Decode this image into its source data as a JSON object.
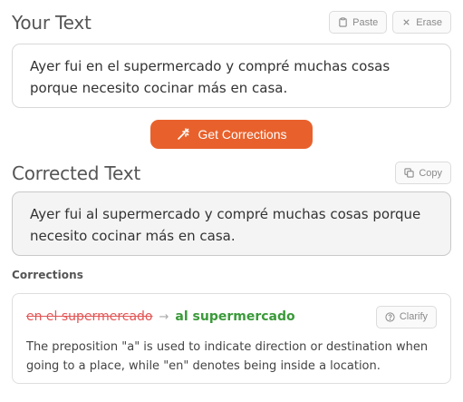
{
  "your_text": {
    "title": "Your Text",
    "paste_label": "Paste",
    "erase_label": "Erase",
    "content": "Ayer fui en el supermercado y compré muchas cosas porque necesito cocinar más en casa."
  },
  "action": {
    "label": "Get Corrections"
  },
  "corrected": {
    "title": "Corrected Text",
    "copy_label": "Copy",
    "content": "Ayer fui al supermercado y compré muchas cosas porque necesito cocinar más en casa."
  },
  "corrections": {
    "label": "Corrections",
    "items": [
      {
        "original": "en el supermercado",
        "arrow": "→",
        "corrected": "al supermercado",
        "clarify_label": "Clarify",
        "explanation": "The preposition \"a\" is used to indicate direction or destination when going to a place, while \"en\" denotes being inside a location."
      }
    ]
  },
  "colors": {
    "accent": "#e8612c",
    "removed": "#e35454",
    "added": "#3a9a3a"
  },
  "icons": {
    "paste": "clipboard-icon",
    "erase": "close-icon",
    "action": "magic-wand-icon",
    "copy": "copy-icon",
    "clarify": "help-circle-icon"
  }
}
